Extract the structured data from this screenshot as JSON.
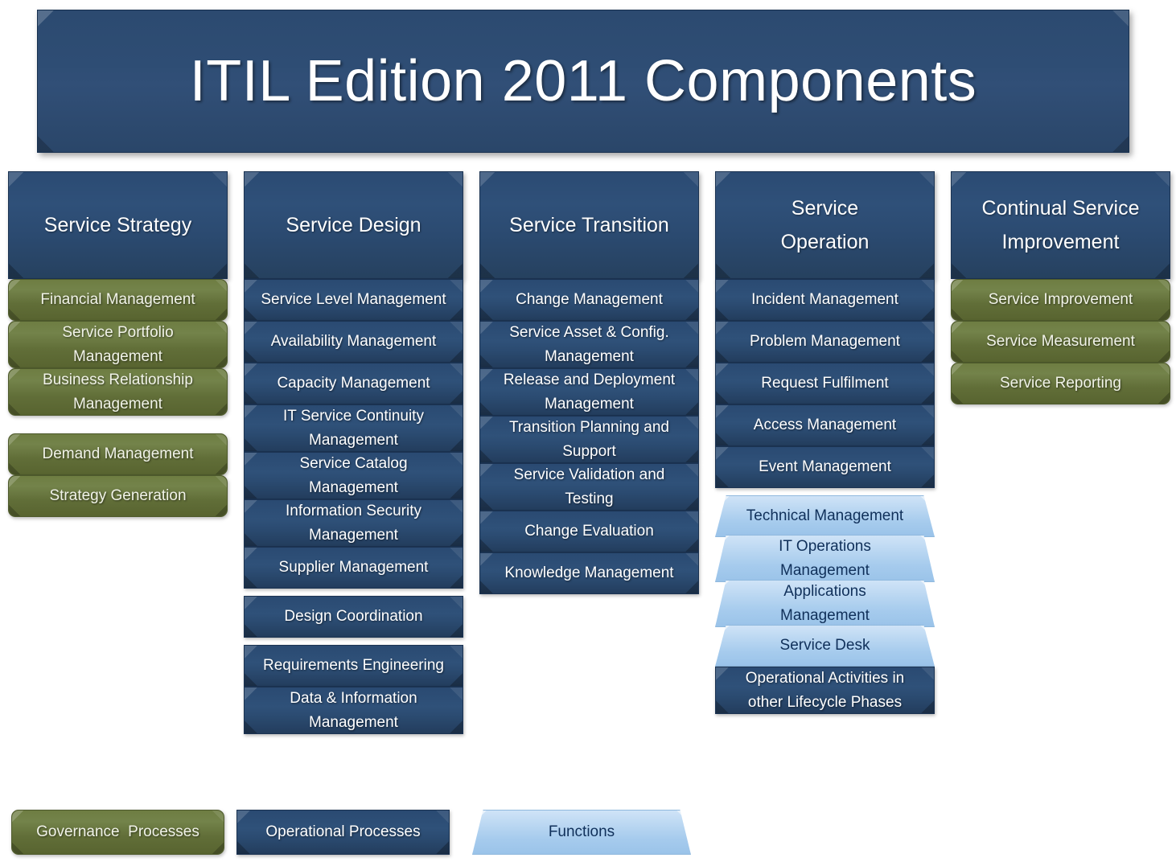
{
  "title": "ITIL Edition 2011 Components",
  "colors": {
    "banner_blue": "#2c4a70",
    "process_blue": "#2a4a72",
    "governance_green": "#6e7d42",
    "function_lightblue": "#bcd8f2",
    "text_light": "#ffffff",
    "text_dark": "#10305a"
  },
  "columns": [
    {
      "header": "Service  Strategy",
      "groups": [
        {
          "gap": "none",
          "items": [
            {
              "label": "Financial Management",
              "kind": "governance"
            },
            {
              "label": "Service Portfolio\nManagement",
              "kind": "governance"
            },
            {
              "label": "Business Relationship\nManagement",
              "kind": "governance"
            }
          ]
        },
        {
          "gap": "md",
          "items": [
            {
              "label": "Demand Management",
              "kind": "governance"
            },
            {
              "label": "Strategy Generation",
              "kind": "governance"
            }
          ]
        }
      ]
    },
    {
      "header": "Service  Design",
      "groups": [
        {
          "gap": "none",
          "items": [
            {
              "label": "Service Level  Management",
              "kind": "operational"
            },
            {
              "label": "Availability Management",
              "kind": "operational"
            },
            {
              "label": "Capacity Management",
              "kind": "operational"
            },
            {
              "label": "IT Service Continuity\nManagement",
              "kind": "operational"
            },
            {
              "label": "Service Catalog\nManagement",
              "kind": "operational"
            },
            {
              "label": "Information Security\nManagement",
              "kind": "operational"
            },
            {
              "label": "Supplier Management",
              "kind": "operational"
            }
          ]
        },
        {
          "gap": "sm",
          "items": [
            {
              "label": "Design Coordination",
              "kind": "operational"
            }
          ]
        },
        {
          "gap": "sm",
          "items": [
            {
              "label": "Requirements Engineering",
              "kind": "operational"
            },
            {
              "label": "Data & Information\nManagement",
              "kind": "operational"
            }
          ]
        }
      ]
    },
    {
      "header": "Service Transition",
      "groups": [
        {
          "gap": "none",
          "items": [
            {
              "label": "Change Management",
              "kind": "operational"
            },
            {
              "label": "Service Asset & Config.\nManagement",
              "kind": "operational"
            },
            {
              "label": "Release and Deployment\nManagement",
              "kind": "operational"
            },
            {
              "label": "Transition Planning and\nSupport",
              "kind": "operational"
            },
            {
              "label": "Service Validation and\nTesting",
              "kind": "operational"
            },
            {
              "label": "Change Evaluation",
              "kind": "operational"
            },
            {
              "label": "Knowledge Management",
              "kind": "operational"
            }
          ]
        }
      ]
    },
    {
      "header": "Service\nOperation",
      "groups": [
        {
          "gap": "none",
          "items": [
            {
              "label": "Incident Management",
              "kind": "operational"
            },
            {
              "label": "Problem Management",
              "kind": "operational"
            },
            {
              "label": "Request Fulfilment",
              "kind": "operational"
            },
            {
              "label": "Access Management",
              "kind": "operational"
            },
            {
              "label": "Event Management",
              "kind": "operational"
            }
          ]
        },
        {
          "gap": "sm",
          "items": [
            {
              "label": "Technical Management",
              "kind": "function"
            },
            {
              "label": "IT Operations\nManagement",
              "kind": "function"
            },
            {
              "label": "Applications\nManagement",
              "kind": "function"
            },
            {
              "label": "Service Desk",
              "kind": "function"
            }
          ]
        },
        {
          "gap": "none",
          "items": [
            {
              "label": "Operational Activities in\nother Lifecycle Phases",
              "kind": "operational"
            }
          ]
        }
      ]
    },
    {
      "header": "Continual Service\nImprovement",
      "groups": [
        {
          "gap": "none",
          "items": [
            {
              "label": "Service Improvement",
              "kind": "governance"
            },
            {
              "label": "Service Measurement",
              "kind": "governance"
            },
            {
              "label": "Service Reporting",
              "kind": "governance"
            }
          ]
        }
      ]
    }
  ],
  "legend": {
    "governance": "Governance  Processes",
    "operational": "Operational Processes",
    "functions": "Functions"
  }
}
